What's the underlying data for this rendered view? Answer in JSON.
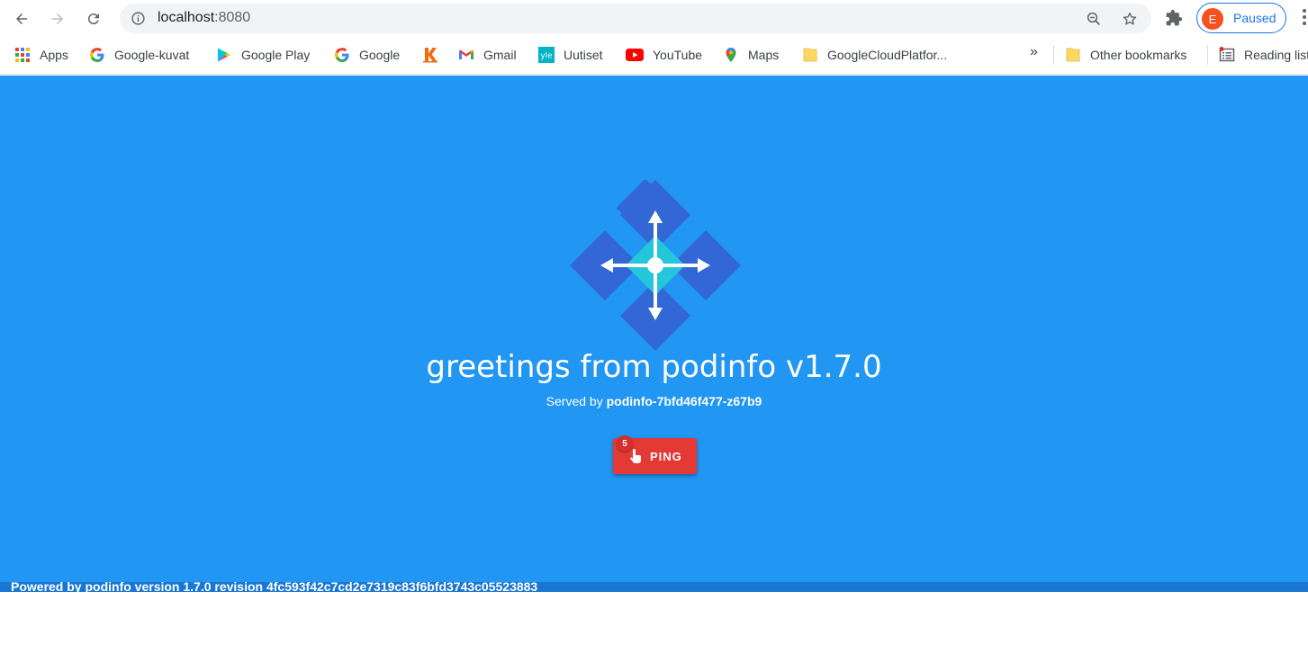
{
  "browser": {
    "url_host": "localhost",
    "url_port": ":8080",
    "profile_initial": "E",
    "profile_status": "Paused"
  },
  "bookmarks": {
    "items": [
      {
        "label": "Apps",
        "icon": "apps-grid-icon"
      },
      {
        "label": "Google-kuvat",
        "icon": "google-g-icon"
      },
      {
        "label": "Google Play",
        "icon": "google-play-icon"
      },
      {
        "label": "Google",
        "icon": "google-g-icon"
      },
      {
        "label": "",
        "icon": "k-logo-icon"
      },
      {
        "label": "Gmail",
        "icon": "gmail-icon"
      },
      {
        "label": "Uutiset",
        "icon": "yle-icon"
      },
      {
        "label": "YouTube",
        "icon": "youtube-icon"
      },
      {
        "label": "Maps",
        "icon": "maps-pin-icon"
      },
      {
        "label": "GoogleCloudPlatfor...",
        "icon": "folder-icon"
      }
    ],
    "overflow_chevrons": "»",
    "other_bookmarks": "Other bookmarks",
    "reading_list": "Reading list"
  },
  "page": {
    "title": "greetings from podinfo v1.7.0",
    "served_prefix": "Served by",
    "served_host": "podinfo-7bfd46f477-z67b9",
    "ping_label": "PING",
    "ping_count": "5",
    "footer": "Powered by podinfo version 1.7.0 revision 4fc593f42c7cd2e7319c83f6bfd3743c05523883"
  },
  "colors": {
    "page_background": "#2196f3",
    "footer_bar": "#1976d2",
    "ping_button": "#e53935",
    "logo_diamonds": "#3367d6",
    "logo_center": "#26c6da"
  }
}
